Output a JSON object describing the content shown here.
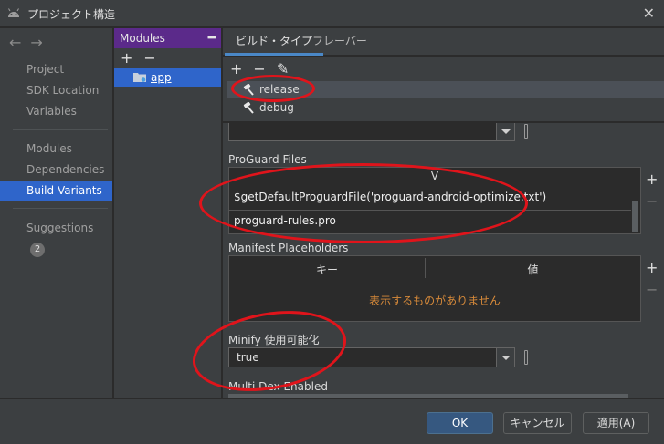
{
  "window": {
    "title": "プロジェクト構造",
    "close_icon": "close-icon"
  },
  "nav": {
    "back_icon": "←",
    "forward_icon": "→",
    "items": [
      {
        "label": "Project"
      },
      {
        "label": "SDK Location"
      },
      {
        "label": "Variables"
      },
      {
        "label": "Modules"
      },
      {
        "label": "Dependencies"
      },
      {
        "label": "Build Variants"
      },
      {
        "label": "Suggestions"
      }
    ],
    "suggestions_count": "2"
  },
  "modules": {
    "header": "Modules",
    "add": "+",
    "remove": "−",
    "items": [
      {
        "label": "app"
      }
    ]
  },
  "tabs": [
    {
      "label": "ビルド・タイプ"
    },
    {
      "label": "フレーバー"
    }
  ],
  "build_types": {
    "add": "+",
    "remove": "−",
    "items": [
      {
        "label": "release"
      },
      {
        "label": "debug"
      }
    ]
  },
  "detail": {
    "proguard_label": "ProGuard Files",
    "proguard_col": "V",
    "proguard_rows": [
      "$getDefaultProguardFile('proguard-android-optimize.txt')",
      "proguard-rules.pro"
    ],
    "manifest_label": "Manifest Placeholders",
    "manifest_cols": [
      "キー",
      "値"
    ],
    "manifest_empty": "表示するものがありません",
    "minify_label": "Minify 使用可能化",
    "minify_value": "true",
    "multidex_label": "Multi Dex Enabled",
    "side_plus": "+",
    "side_minus": "−"
  },
  "footer": {
    "ok": "OK",
    "cancel": "キャンセル",
    "apply": "適用(A)"
  },
  "colors": {
    "accent_blue": "#2f65ca",
    "module_header": "#5b2a8a",
    "annotation_red": "#e0141b",
    "empty_text": "#d78a3a"
  }
}
